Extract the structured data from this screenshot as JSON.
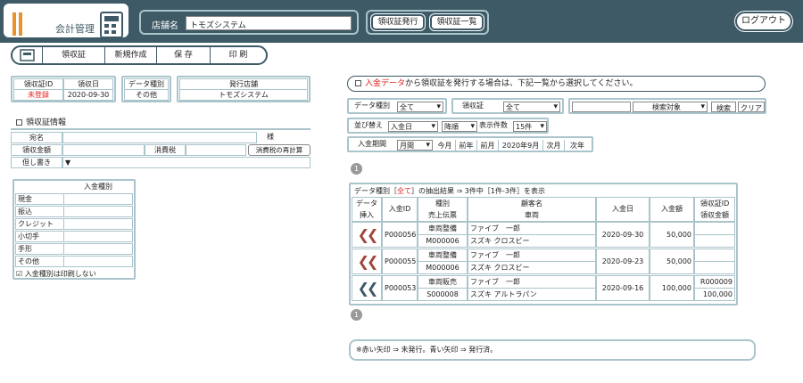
{
  "header": {
    "app_title": "会計管理",
    "shop_label": "店舗名",
    "shop_value": "トモズシステム",
    "btn_issue": "領収証発行",
    "btn_list": "領収証一覧",
    "btn_logout": "ログアウト"
  },
  "toolbar": {
    "receipt": "領収証",
    "new": "新規作成",
    "save": "保 存",
    "print": "印 刷"
  },
  "meta": {
    "id_label": "領収証ID",
    "id_value": "未登録",
    "date_label": "領収日",
    "date_value": "2020-09-30",
    "type_label": "データ種別",
    "type_value": "その他",
    "store_label": "発行店舗",
    "store_value": "トモズシステム"
  },
  "info": {
    "title": "領収証情報",
    "addressee_label": "宛名",
    "sama": "様",
    "amount_label": "領収金額",
    "tax_label": "消費税",
    "recalc": "消費税の再計算",
    "note_label": "但し書き",
    "note_caret": "▼"
  },
  "payment": {
    "title": "入金種別",
    "items": [
      "現金",
      "振込",
      "クレジット",
      "小切手",
      "手形",
      "その他"
    ],
    "checkbox_label": "入金種別は印刷しない",
    "check": "☑"
  },
  "right": {
    "notice_prefix": "入金データ",
    "notice_rest": "から領収証を発行する場合は、下記一覧から選択してください。",
    "f_type_label": "データ種別",
    "f_type_value": "全て",
    "f_receipt_label": "領収証",
    "f_receipt_value": "全て",
    "f_target_value": "検索対象",
    "search": "検索",
    "clear": "クリア",
    "sort_label": "並び替え",
    "sort_value": "入金日",
    "order_value": "降順",
    "count_label": "表示件数",
    "count_value": "15件",
    "period_label": "入金期間",
    "period_value": "月間",
    "p_this_month": "今月",
    "p_prev_year": "前年",
    "p_prev_month": "前月",
    "p_current": "2020年9月",
    "p_next_month": "次月",
    "p_next_year": "次年",
    "page_top": "1",
    "page_bottom": "1",
    "result_a": "データ種別［",
    "result_b": "全て",
    "result_c": "］の抽出結果 ⇒ 3件中［1件-3件］を表示",
    "legend": "※赤い矢印 ⇒ 未発行。青い矢印 ⇒ 発行済。"
  },
  "table": {
    "h_insert1": "データ",
    "h_insert2": "挿入",
    "h_id": "入金ID",
    "h_kind": "種別",
    "h_slip": "売上伝票",
    "h_customer": "顧客名",
    "h_vehicle": "車両",
    "h_date": "入金日",
    "h_amount": "入金額",
    "h_rid": "領収証ID",
    "h_ramount": "領収金額",
    "rows": [
      {
        "id": "P000056",
        "kind": "車両整備",
        "slip": "M000006",
        "customer": "ファイブ　一郎",
        "vehicle": "スズキ クロスビー",
        "date": "2020-09-30",
        "amount": "50,000",
        "rid": "",
        "ramount": "",
        "arrow": "❮❮",
        "arrow_color": "#a0473c"
      },
      {
        "id": "P000055",
        "kind": "車両整備",
        "slip": "M000006",
        "customer": "ファイブ　一郎",
        "vehicle": "スズキ クロスビー",
        "date": "2020-09-23",
        "amount": "50,000",
        "rid": "",
        "ramount": "",
        "arrow": "❮❮",
        "arrow_color": "#a0473c"
      },
      {
        "id": "P000053",
        "kind": "車両販売",
        "slip": "S000008",
        "customer": "ファイブ　一郎",
        "vehicle": "スズキ アルトラパン",
        "date": "2020-09-16",
        "amount": "100,000",
        "rid": "R000009",
        "ramount": "100,000",
        "arrow": "❮❮",
        "arrow_color": "#3d5a66"
      }
    ]
  },
  "colors": {
    "header_bg": "#3d5a66",
    "accent": "#e8912e",
    "border": "#aac4cc",
    "red": "#e41e1e"
  },
  "icons": {
    "logo": "accounting-logo-icon",
    "calculator": "calculator-icon",
    "receipt": "receipt-icon"
  }
}
